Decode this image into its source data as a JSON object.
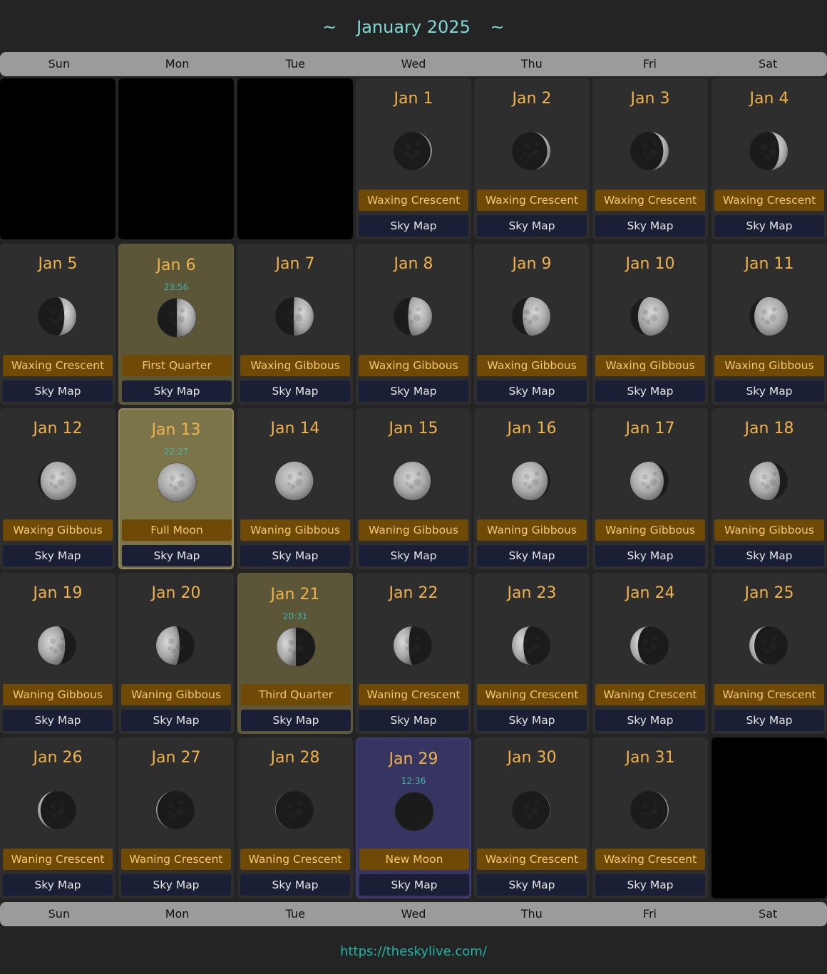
{
  "title": "January 2025",
  "title_decoration": "~",
  "weekdays": [
    "Sun",
    "Mon",
    "Tue",
    "Wed",
    "Thu",
    "Fri",
    "Sat"
  ],
  "footer_url": "https://theskylive.com/",
  "sky_map_label": "Sky Map",
  "colors": {
    "background": "#242424",
    "date_text": "#f0b24b",
    "phase_bg": "#6e4a06",
    "skymap_bg": "#1a1f36",
    "accent_teal": "#7fd9d2",
    "quarter_bg": "#5a5637",
    "full_moon_bg": "#7a7448",
    "new_moon_bg": "#363460"
  },
  "leading_blanks": 3,
  "trailing_blanks": 1,
  "days": [
    {
      "date": "Jan 1",
      "phase": "Waxing Crescent",
      "illum": 0.04,
      "waxing": true
    },
    {
      "date": "Jan 2",
      "phase": "Waxing Crescent",
      "illum": 0.08,
      "waxing": true
    },
    {
      "date": "Jan 3",
      "phase": "Waxing Crescent",
      "illum": 0.14,
      "waxing": true
    },
    {
      "date": "Jan 4",
      "phase": "Waxing Crescent",
      "illum": 0.22,
      "waxing": true
    },
    {
      "date": "Jan 5",
      "phase": "Waxing Crescent",
      "illum": 0.31,
      "waxing": true
    },
    {
      "date": "Jan 6",
      "phase": "First Quarter",
      "illum": 0.5,
      "waxing": true,
      "time": "23:56",
      "highlight": "quarter"
    },
    {
      "date": "Jan 7",
      "phase": "Waxing Gibbous",
      "illum": 0.52,
      "waxing": true
    },
    {
      "date": "Jan 8",
      "phase": "Waxing Gibbous",
      "illum": 0.62,
      "waxing": true
    },
    {
      "date": "Jan 9",
      "phase": "Waxing Gibbous",
      "illum": 0.72,
      "waxing": true
    },
    {
      "date": "Jan 10",
      "phase": "Waxing Gibbous",
      "illum": 0.8,
      "waxing": true
    },
    {
      "date": "Jan 11",
      "phase": "Waxing Gibbous",
      "illum": 0.87,
      "waxing": true
    },
    {
      "date": "Jan 12",
      "phase": "Waxing Gibbous",
      "illum": 0.93,
      "waxing": true
    },
    {
      "date": "Jan 13",
      "phase": "Full Moon",
      "illum": 1.0,
      "waxing": true,
      "time": "22:27",
      "highlight": "full"
    },
    {
      "date": "Jan 14",
      "phase": "Waning Gibbous",
      "illum": 0.99,
      "waxing": false
    },
    {
      "date": "Jan 15",
      "phase": "Waning Gibbous",
      "illum": 0.97,
      "waxing": false
    },
    {
      "date": "Jan 16",
      "phase": "Waning Gibbous",
      "illum": 0.93,
      "waxing": false
    },
    {
      "date": "Jan 17",
      "phase": "Waning Gibbous",
      "illum": 0.87,
      "waxing": false
    },
    {
      "date": "Jan 18",
      "phase": "Waning Gibbous",
      "illum": 0.8,
      "waxing": false
    },
    {
      "date": "Jan 19",
      "phase": "Waning Gibbous",
      "illum": 0.71,
      "waxing": false
    },
    {
      "date": "Jan 20",
      "phase": "Waning Gibbous",
      "illum": 0.61,
      "waxing": false
    },
    {
      "date": "Jan 21",
      "phase": "Third Quarter",
      "illum": 0.5,
      "waxing": false,
      "time": "20:31",
      "highlight": "quarter"
    },
    {
      "date": "Jan 22",
      "phase": "Waning Crescent",
      "illum": 0.4,
      "waxing": false
    },
    {
      "date": "Jan 23",
      "phase": "Waning Crescent",
      "illum": 0.3,
      "waxing": false
    },
    {
      "date": "Jan 24",
      "phase": "Waning Crescent",
      "illum": 0.2,
      "waxing": false
    },
    {
      "date": "Jan 25",
      "phase": "Waning Crescent",
      "illum": 0.13,
      "waxing": false
    },
    {
      "date": "Jan 26",
      "phase": "Waning Crescent",
      "illum": 0.07,
      "waxing": false
    },
    {
      "date": "Jan 27",
      "phase": "Waning Crescent",
      "illum": 0.03,
      "waxing": false
    },
    {
      "date": "Jan 28",
      "phase": "Waning Crescent",
      "illum": 0.01,
      "waxing": false
    },
    {
      "date": "Jan 29",
      "phase": "New Moon",
      "illum": 0.0,
      "waxing": true,
      "time": "12:36",
      "highlight": "new"
    },
    {
      "date": "Jan 30",
      "phase": "Waxing Crescent",
      "illum": 0.01,
      "waxing": true
    },
    {
      "date": "Jan 31",
      "phase": "Waxing Crescent",
      "illum": 0.03,
      "waxing": true
    }
  ]
}
